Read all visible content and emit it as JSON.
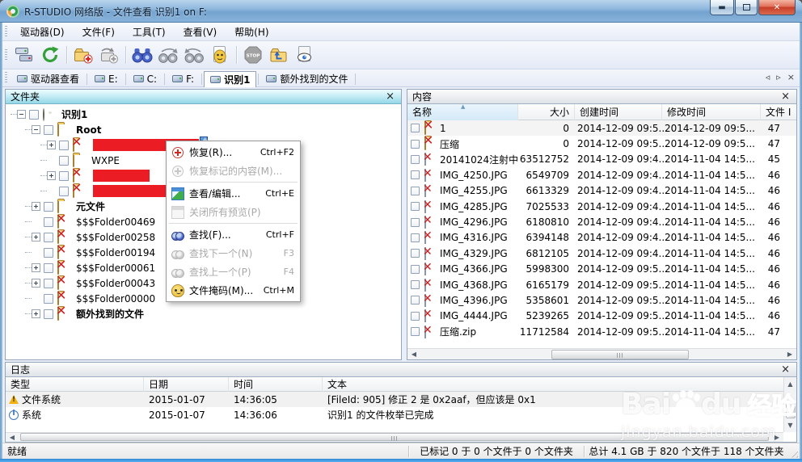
{
  "window": {
    "title": "R-STUDIO 网络版 - 文件查看 识别1 on F:",
    "controls": {
      "minimize": "最小化",
      "maximize": "最大化",
      "close": "关闭"
    }
  },
  "menu_bar": {
    "items": [
      {
        "label": "驱动器(D)"
      },
      {
        "label": "文件(F)"
      },
      {
        "label": "工具(T)"
      },
      {
        "label": "查看(V)"
      },
      {
        "label": "帮助(H)"
      }
    ]
  },
  "toolbar": {
    "buttons": [
      "connect-drives",
      "refresh",
      "recover",
      "recover-marked",
      "find",
      "find-next",
      "find-previous",
      "file-mask",
      "stop",
      "open-drive-file",
      "preview"
    ]
  },
  "tab_bar": {
    "tabs": [
      {
        "label": "驱动器查看",
        "cls": "plain"
      },
      {
        "label": "E:",
        "cls": "plain"
      },
      {
        "label": "C:",
        "cls": "plain"
      },
      {
        "label": "F:",
        "cls": "plain"
      },
      {
        "label": "识别1",
        "cls": "active"
      },
      {
        "label": "额外找到的文件",
        "cls": "plain"
      }
    ]
  },
  "folders_panel": {
    "title": "文件夹",
    "tree": [
      {
        "label": "识别1",
        "cls": "lvl0 bold",
        "exp": "exp-minus",
        "icon": "disk-icon"
      },
      {
        "label": "Root",
        "cls": "lvl1 bold",
        "exp": "exp-minus",
        "icon": "folder-icon"
      },
      {
        "label": "",
        "cls": "lvl2",
        "exp": "exp-plus",
        "icon": "folder-x-icon",
        "redact_style": "width:131px",
        "badge": true
      },
      {
        "label": "WXPE",
        "cls": "lvl2",
        "exp": "exp-none",
        "icon": "folder-icon"
      },
      {
        "label": "",
        "cls": "lvl2",
        "exp": "exp-plus",
        "icon": "folder-x-icon",
        "redact_style": "width:70px"
      },
      {
        "label": "",
        "cls": "lvl2",
        "exp": "exp-none",
        "icon": "folder-x-icon",
        "redact_style": "width:93px"
      },
      {
        "label": "元文件",
        "cls": "lvl1 bold",
        "exp": "exp-plus",
        "icon": "folder-icon"
      },
      {
        "label": "$$$Folder00469",
        "cls": "lvl1",
        "exp": "exp-none",
        "icon": "folder-x-icon"
      },
      {
        "label": "$$$Folder00258",
        "cls": "lvl1",
        "exp": "exp-plus",
        "icon": "folder-x-icon"
      },
      {
        "label": "$$$Folder00194",
        "cls": "lvl1",
        "exp": "exp-none",
        "icon": "folder-x-icon"
      },
      {
        "label": "$$$Folder00061",
        "cls": "lvl1",
        "exp": "exp-plus",
        "icon": "folder-x-icon"
      },
      {
        "label": "$$$Folder00043",
        "cls": "lvl1",
        "exp": "exp-plus",
        "icon": "folder-x-icon"
      },
      {
        "label": "$$$Folder00000",
        "cls": "lvl1",
        "exp": "exp-none",
        "icon": "folder-x-icon"
      },
      {
        "label": "额外找到的文件",
        "cls": "lvl1 bold",
        "exp": "exp-plus",
        "icon": "folder-x-icon"
      }
    ]
  },
  "context_menu": {
    "items": [
      {
        "label": "恢复(R)...",
        "shortcut": "Ctrl+F2",
        "icon": "mi-recover",
        "cls": "enabled"
      },
      {
        "label": "恢复标记的内容(M)...",
        "shortcut": "",
        "icon": "mi-recover-marked",
        "cls": "disabled"
      },
      {
        "sep": true
      },
      {
        "label": "查看/编辑...",
        "shortcut": "Ctrl+E",
        "icon": "mi-view-edit",
        "cls": "enabled"
      },
      {
        "label": "关闭所有预览(P)",
        "shortcut": "",
        "icon": "mi-close-previews",
        "cls": "disabled"
      },
      {
        "sep": true
      },
      {
        "label": "查找(F)...",
        "shortcut": "Ctrl+F",
        "icon": "mi-find",
        "cls": "enabled"
      },
      {
        "label": "查找下一个(N)",
        "shortcut": "F3",
        "icon": "mi-find-next",
        "cls": "disabled"
      },
      {
        "label": "查找上一个(P)",
        "shortcut": "F4",
        "icon": "mi-find-prev",
        "cls": "disabled"
      },
      {
        "label": "文件掩码(M)...",
        "shortcut": "Ctrl+M",
        "icon": "mi-file-mask",
        "cls": "enabled"
      }
    ]
  },
  "content_panel": {
    "title": "内容",
    "columns": {
      "name": "名称",
      "size": "大小",
      "created": "创建时间",
      "modified": "修改时间",
      "file_id": "文件 I"
    },
    "rows": [
      {
        "icon": "folder-x-icon",
        "name": "1",
        "size": "0",
        "created": "2014-12-09 09:5...",
        "modified": "2014-12-09 09:5...",
        "file_id": "47",
        "cls": "shade"
      },
      {
        "icon": "folder-x-icon",
        "name": "压缩",
        "size": "0",
        "created": "2014-12-09 09:5...",
        "modified": "2014-12-09 09:5...",
        "file_id": "47"
      },
      {
        "icon": "file-x-icon",
        "name": "20141024注射中...",
        "size": "63512752",
        "created": "2014-12-09 09:4...",
        "modified": "2014-11-04 14:5...",
        "file_id": "45"
      },
      {
        "icon": "file-x-icon",
        "name": "IMG_4250.JPG",
        "size": "6549709",
        "created": "2014-12-09 09:4...",
        "modified": "2014-11-04 14:5...",
        "file_id": "46"
      },
      {
        "icon": "file-x-icon",
        "name": "IMG_4255.JPG",
        "size": "6613329",
        "created": "2014-12-09 09:4...",
        "modified": "2014-11-04 14:5...",
        "file_id": "46"
      },
      {
        "icon": "file-x-icon",
        "name": "IMG_4285.JPG",
        "size": "7025533",
        "created": "2014-12-09 09:4...",
        "modified": "2014-11-04 14:5...",
        "file_id": "46"
      },
      {
        "icon": "file-x-icon",
        "name": "IMG_4296.JPG",
        "size": "6180810",
        "created": "2014-12-09 09:4...",
        "modified": "2014-11-04 14:5...",
        "file_id": "46"
      },
      {
        "icon": "file-x-icon",
        "name": "IMG_4316.JPG",
        "size": "6394148",
        "created": "2014-12-09 09:4...",
        "modified": "2014-11-04 14:5...",
        "file_id": "46"
      },
      {
        "icon": "file-x-icon",
        "name": "IMG_4329.JPG",
        "size": "6812105",
        "created": "2014-12-09 09:4...",
        "modified": "2014-11-04 14:5...",
        "file_id": "46"
      },
      {
        "icon": "file-x-icon",
        "name": "IMG_4366.JPG",
        "size": "5998300",
        "created": "2014-12-09 09:5...",
        "modified": "2014-11-04 14:5...",
        "file_id": "46"
      },
      {
        "icon": "file-x-icon",
        "name": "IMG_4368.JPG",
        "size": "6165179",
        "created": "2014-12-09 09:5...",
        "modified": "2014-11-04 14:5...",
        "file_id": "46"
      },
      {
        "icon": "file-x-icon",
        "name": "IMG_4396.JPG",
        "size": "5358601",
        "created": "2014-12-09 09:5...",
        "modified": "2014-11-04 14:5...",
        "file_id": "46"
      },
      {
        "icon": "file-x-icon",
        "name": "IMG_4444.JPG",
        "size": "5239265",
        "created": "2014-12-09 09:5...",
        "modified": "2014-11-04 14:5...",
        "file_id": "46"
      },
      {
        "icon": "file-x-icon",
        "name": "压缩.zip",
        "size": "11712584",
        "created": "2014-12-09 09:5...",
        "modified": "2014-11-04 14:5...",
        "file_id": "47"
      }
    ]
  },
  "log_panel": {
    "title": "日志",
    "columns": {
      "type": "类型",
      "date": "日期",
      "time": "时间",
      "text": "文本"
    },
    "rows": [
      {
        "icon": "warn-icon",
        "type": "文件系统",
        "date": "2015-01-07",
        "time": "14:36:05",
        "text": "[FileId: 905] 修正 2 是 0x2aaf，但应该是 0x1",
        "cls": "shade"
      },
      {
        "icon": "info-icon",
        "type": "系统",
        "date": "2015-01-07",
        "time": "14:36:06",
        "text": "识别1 的文件枚举已完成"
      }
    ]
  },
  "status_bar": {
    "ready": "就绪",
    "marked": "已标记 0 于 0 个文件于 0 个文件夹",
    "total": "总计 4.1 GB 于 820 个文件于 118 个文件夹"
  },
  "watermark": {
    "brand_left": "Bai",
    "brand_right": "du",
    "badge": "经验",
    "url": "jingyan.baidu.com"
  },
  "colors": {
    "titlebar_blue": "#74a3cf",
    "active_panel_header": "#93d7e7",
    "redaction_red": "#ec1c24",
    "window_border_bottom": "#2f89d4",
    "sorted_column_highlight": "#d4eaf8"
  }
}
